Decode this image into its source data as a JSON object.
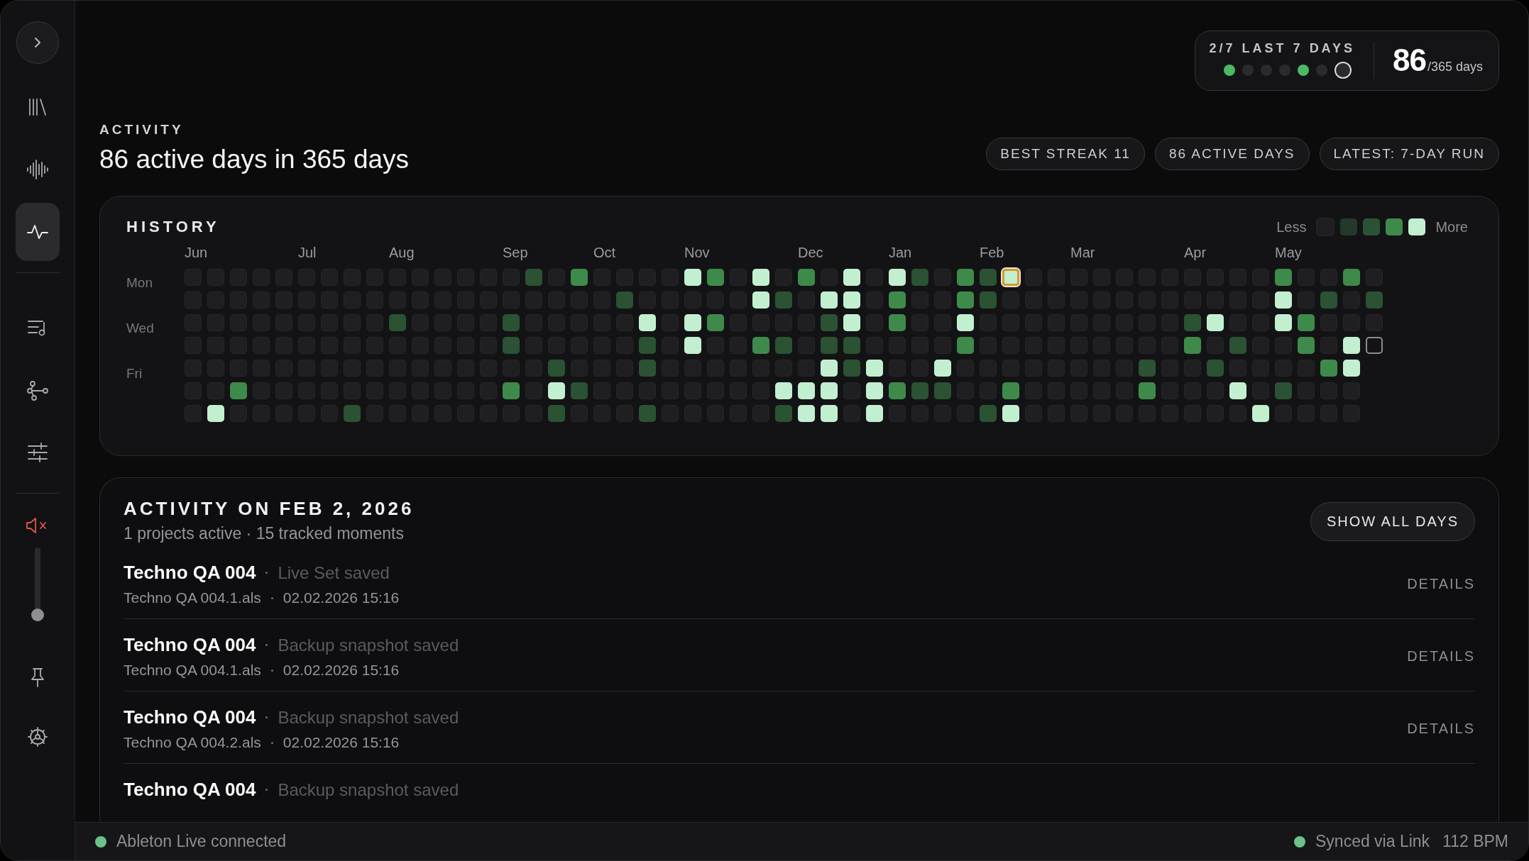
{
  "sidebar": {
    "toggle": {
      "kind": "expand"
    },
    "nav_top": [
      {
        "kind": "library",
        "selected": false
      },
      {
        "kind": "waveform",
        "selected": false
      },
      {
        "kind": "activity",
        "selected": true
      }
    ],
    "nav_mid": [
      {
        "kind": "playlist",
        "selected": false
      },
      {
        "kind": "nodes",
        "selected": false
      },
      {
        "kind": "sliders",
        "selected": false
      }
    ],
    "volume": {
      "muted": true,
      "level": 0
    },
    "nav_bottom": [
      {
        "kind": "pin",
        "selected": false
      },
      {
        "kind": "settings",
        "selected": false
      }
    ]
  },
  "streak": {
    "label": "2/7 LAST 7 DAYS",
    "days": [
      {
        "active": true,
        "current": false
      },
      {
        "active": false,
        "current": false
      },
      {
        "active": false,
        "current": false
      },
      {
        "active": false,
        "current": false
      },
      {
        "active": true,
        "current": false
      },
      {
        "active": false,
        "current": false
      },
      {
        "active": false,
        "current": true
      }
    ],
    "count": "86",
    "total": "/365 days"
  },
  "header": {
    "eyebrow": "ACTIVITY",
    "title": "86 active days in 365 days",
    "chips": [
      "BEST STREAK 11",
      "86 ACTIVE DAYS",
      "LATEST: 7-DAY RUN"
    ]
  },
  "history": {
    "title": "HISTORY",
    "legend": {
      "less": "Less",
      "more": "More",
      "swatches": [
        {
          "kind": "none"
        },
        {
          "kind": "low"
        },
        {
          "kind": "medium"
        },
        {
          "kind": "high"
        },
        {
          "kind": "max"
        }
      ]
    },
    "weekdays": [
      "Mon",
      "Wed",
      "Fri"
    ],
    "weeks": [
      {
        "month": "Jun",
        "days": [
          {
            "kind": "none"
          },
          {
            "kind": "none"
          },
          {
            "kind": "none"
          },
          {
            "kind": "none"
          },
          {
            "kind": "none"
          },
          {
            "kind": "none"
          },
          {
            "kind": "none"
          }
        ]
      },
      {
        "days": [
          {
            "kind": "none"
          },
          {
            "kind": "none"
          },
          {
            "kind": "none"
          },
          {
            "kind": "none"
          },
          {
            "kind": "none"
          },
          {
            "kind": "none"
          },
          {
            "kind": "max"
          }
        ]
      },
      {
        "days": [
          {
            "kind": "none"
          },
          {
            "kind": "none"
          },
          {
            "kind": "none"
          },
          {
            "kind": "none"
          },
          {
            "kind": "none"
          },
          {
            "kind": "high"
          },
          {
            "kind": "none"
          }
        ]
      },
      {
        "days": [
          {
            "kind": "none"
          },
          {
            "kind": "none"
          },
          {
            "kind": "none"
          },
          {
            "kind": "none"
          },
          {
            "kind": "none"
          },
          {
            "kind": "none"
          },
          {
            "kind": "none"
          }
        ]
      },
      {
        "days": [
          {
            "kind": "none"
          },
          {
            "kind": "none"
          },
          {
            "kind": "none"
          },
          {
            "kind": "none"
          },
          {
            "kind": "none"
          },
          {
            "kind": "none"
          },
          {
            "kind": "none"
          }
        ]
      },
      {
        "month": "Jul",
        "days": [
          {
            "kind": "none"
          },
          {
            "kind": "none"
          },
          {
            "kind": "none"
          },
          {
            "kind": "none"
          },
          {
            "kind": "none"
          },
          {
            "kind": "none"
          },
          {
            "kind": "none"
          }
        ]
      },
      {
        "days": [
          {
            "kind": "none"
          },
          {
            "kind": "none"
          },
          {
            "kind": "none"
          },
          {
            "kind": "none"
          },
          {
            "kind": "none"
          },
          {
            "kind": "none"
          },
          {
            "kind": "none"
          }
        ]
      },
      {
        "days": [
          {
            "kind": "none"
          },
          {
            "kind": "none"
          },
          {
            "kind": "none"
          },
          {
            "kind": "none"
          },
          {
            "kind": "none"
          },
          {
            "kind": "none"
          },
          {
            "kind": "medium"
          }
        ]
      },
      {
        "days": [
          {
            "kind": "none"
          },
          {
            "kind": "none"
          },
          {
            "kind": "none"
          },
          {
            "kind": "none"
          },
          {
            "kind": "none"
          },
          {
            "kind": "none"
          },
          {
            "kind": "none"
          }
        ]
      },
      {
        "month": "Aug",
        "days": [
          {
            "kind": "none"
          },
          {
            "kind": "none"
          },
          {
            "kind": "medium"
          },
          {
            "kind": "none"
          },
          {
            "kind": "none"
          },
          {
            "kind": "none"
          },
          {
            "kind": "none"
          }
        ]
      },
      {
        "days": [
          {
            "kind": "none"
          },
          {
            "kind": "none"
          },
          {
            "kind": "none"
          },
          {
            "kind": "none"
          },
          {
            "kind": "none"
          },
          {
            "kind": "none"
          },
          {
            "kind": "none"
          }
        ]
      },
      {
        "days": [
          {
            "kind": "none"
          },
          {
            "kind": "none"
          },
          {
            "kind": "none"
          },
          {
            "kind": "none"
          },
          {
            "kind": "none"
          },
          {
            "kind": "none"
          },
          {
            "kind": "none"
          }
        ]
      },
      {
        "days": [
          {
            "kind": "none"
          },
          {
            "kind": "none"
          },
          {
            "kind": "none"
          },
          {
            "kind": "none"
          },
          {
            "kind": "none"
          },
          {
            "kind": "none"
          },
          {
            "kind": "none"
          }
        ]
      },
      {
        "days": [
          {
            "kind": "none"
          },
          {
            "kind": "none"
          },
          {
            "kind": "none"
          },
          {
            "kind": "none"
          },
          {
            "kind": "none"
          },
          {
            "kind": "none"
          },
          {
            "kind": "none"
          }
        ]
      },
      {
        "month": "Sep",
        "days": [
          {
            "kind": "none"
          },
          {
            "kind": "none"
          },
          {
            "kind": "medium"
          },
          {
            "kind": "medium"
          },
          {
            "kind": "none"
          },
          {
            "kind": "high"
          },
          {
            "kind": "none"
          }
        ]
      },
      {
        "days": [
          {
            "kind": "medium"
          },
          {
            "kind": "none"
          },
          {
            "kind": "none"
          },
          {
            "kind": "none"
          },
          {
            "kind": "none"
          },
          {
            "kind": "none"
          },
          {
            "kind": "none"
          }
        ]
      },
      {
        "days": [
          {
            "kind": "none"
          },
          {
            "kind": "none"
          },
          {
            "kind": "none"
          },
          {
            "kind": "none"
          },
          {
            "kind": "medium"
          },
          {
            "kind": "max"
          },
          {
            "kind": "medium"
          }
        ]
      },
      {
        "days": [
          {
            "kind": "high"
          },
          {
            "kind": "none"
          },
          {
            "kind": "none"
          },
          {
            "kind": "none"
          },
          {
            "kind": "none"
          },
          {
            "kind": "medium"
          },
          {
            "kind": "none"
          }
        ]
      },
      {
        "month": "Oct",
        "days": [
          {
            "kind": "none"
          },
          {
            "kind": "none"
          },
          {
            "kind": "none"
          },
          {
            "kind": "none"
          },
          {
            "kind": "none"
          },
          {
            "kind": "none"
          },
          {
            "kind": "none"
          }
        ]
      },
      {
        "days": [
          {
            "kind": "none"
          },
          {
            "kind": "medium"
          },
          {
            "kind": "none"
          },
          {
            "kind": "none"
          },
          {
            "kind": "none"
          },
          {
            "kind": "none"
          },
          {
            "kind": "none"
          }
        ]
      },
      {
        "days": [
          {
            "kind": "none"
          },
          {
            "kind": "none"
          },
          {
            "kind": "max"
          },
          {
            "kind": "medium"
          },
          {
            "kind": "medium"
          },
          {
            "kind": "none"
          },
          {
            "kind": "medium"
          }
        ]
      },
      {
        "days": [
          {
            "kind": "none"
          },
          {
            "kind": "none"
          },
          {
            "kind": "none"
          },
          {
            "kind": "none"
          },
          {
            "kind": "none"
          },
          {
            "kind": "none"
          },
          {
            "kind": "none"
          }
        ]
      },
      {
        "month": "Nov",
        "days": [
          {
            "kind": "max"
          },
          {
            "kind": "none"
          },
          {
            "kind": "max"
          },
          {
            "kind": "max"
          },
          {
            "kind": "none"
          },
          {
            "kind": "none"
          },
          {
            "kind": "none"
          }
        ]
      },
      {
        "days": [
          {
            "kind": "high"
          },
          {
            "kind": "none"
          },
          {
            "kind": "high"
          },
          {
            "kind": "none"
          },
          {
            "kind": "none"
          },
          {
            "kind": "none"
          },
          {
            "kind": "none"
          }
        ]
      },
      {
        "days": [
          {
            "kind": "none"
          },
          {
            "kind": "none"
          },
          {
            "kind": "none"
          },
          {
            "kind": "none"
          },
          {
            "kind": "none"
          },
          {
            "kind": "none"
          },
          {
            "kind": "none"
          }
        ]
      },
      {
        "days": [
          {
            "kind": "max"
          },
          {
            "kind": "max"
          },
          {
            "kind": "none"
          },
          {
            "kind": "high"
          },
          {
            "kind": "none"
          },
          {
            "kind": "none"
          },
          {
            "kind": "none"
          }
        ]
      },
      {
        "days": [
          {
            "kind": "none"
          },
          {
            "kind": "medium"
          },
          {
            "kind": "none"
          },
          {
            "kind": "medium"
          },
          {
            "kind": "none"
          },
          {
            "kind": "max"
          },
          {
            "kind": "medium"
          }
        ]
      },
      {
        "month": "Dec",
        "days": [
          {
            "kind": "high"
          },
          {
            "kind": "none"
          },
          {
            "kind": "none"
          },
          {
            "kind": "none"
          },
          {
            "kind": "none"
          },
          {
            "kind": "max"
          },
          {
            "kind": "max"
          }
        ]
      },
      {
        "days": [
          {
            "kind": "none"
          },
          {
            "kind": "max"
          },
          {
            "kind": "medium"
          },
          {
            "kind": "medium"
          },
          {
            "kind": "max"
          },
          {
            "kind": "max"
          },
          {
            "kind": "max"
          }
        ]
      },
      {
        "days": [
          {
            "kind": "max"
          },
          {
            "kind": "max"
          },
          {
            "kind": "max"
          },
          {
            "kind": "medium"
          },
          {
            "kind": "medium"
          },
          {
            "kind": "none"
          },
          {
            "kind": "none"
          }
        ]
      },
      {
        "days": [
          {
            "kind": "none"
          },
          {
            "kind": "none"
          },
          {
            "kind": "none"
          },
          {
            "kind": "none"
          },
          {
            "kind": "max"
          },
          {
            "kind": "max"
          },
          {
            "kind": "max"
          }
        ]
      },
      {
        "month": "Jan",
        "days": [
          {
            "kind": "max"
          },
          {
            "kind": "high"
          },
          {
            "kind": "high"
          },
          {
            "kind": "none"
          },
          {
            "kind": "none"
          },
          {
            "kind": "high"
          },
          {
            "kind": "none"
          }
        ]
      },
      {
        "days": [
          {
            "kind": "medium"
          },
          {
            "kind": "none"
          },
          {
            "kind": "none"
          },
          {
            "kind": "none"
          },
          {
            "kind": "none"
          },
          {
            "kind": "medium"
          },
          {
            "kind": "none"
          }
        ]
      },
      {
        "days": [
          {
            "kind": "none"
          },
          {
            "kind": "none"
          },
          {
            "kind": "none"
          },
          {
            "kind": "none"
          },
          {
            "kind": "max"
          },
          {
            "kind": "medium"
          },
          {
            "kind": "none"
          }
        ]
      },
      {
        "days": [
          {
            "kind": "high"
          },
          {
            "kind": "high"
          },
          {
            "kind": "max"
          },
          {
            "kind": "high"
          },
          {
            "kind": "none"
          },
          {
            "kind": "none"
          },
          {
            "kind": "none"
          }
        ]
      },
      {
        "month": "Feb",
        "days": [
          {
            "kind": "medium"
          },
          {
            "kind": "medium"
          },
          {
            "kind": "none"
          },
          {
            "kind": "none"
          },
          {
            "kind": "none"
          },
          {
            "kind": "none"
          },
          {
            "kind": "medium"
          }
        ]
      },
      {
        "days": [
          {
            "kind": "selected"
          },
          {
            "kind": "none"
          },
          {
            "kind": "none"
          },
          {
            "kind": "none"
          },
          {
            "kind": "none"
          },
          {
            "kind": "high"
          },
          {
            "kind": "max"
          }
        ]
      },
      {
        "days": [
          {
            "kind": "none"
          },
          {
            "kind": "none"
          },
          {
            "kind": "none"
          },
          {
            "kind": "none"
          },
          {
            "kind": "none"
          },
          {
            "kind": "none"
          },
          {
            "kind": "none"
          }
        ]
      },
      {
        "days": [
          {
            "kind": "none"
          },
          {
            "kind": "none"
          },
          {
            "kind": "none"
          },
          {
            "kind": "none"
          },
          {
            "kind": "none"
          },
          {
            "kind": "none"
          },
          {
            "kind": "none"
          }
        ]
      },
      {
        "month": "Mar",
        "days": [
          {
            "kind": "none"
          },
          {
            "kind": "none"
          },
          {
            "kind": "none"
          },
          {
            "kind": "none"
          },
          {
            "kind": "none"
          },
          {
            "kind": "none"
          },
          {
            "kind": "none"
          }
        ]
      },
      {
        "days": [
          {
            "kind": "none"
          },
          {
            "kind": "none"
          },
          {
            "kind": "none"
          },
          {
            "kind": "none"
          },
          {
            "kind": "none"
          },
          {
            "kind": "none"
          },
          {
            "kind": "none"
          }
        ]
      },
      {
        "days": [
          {
            "kind": "none"
          },
          {
            "kind": "none"
          },
          {
            "kind": "none"
          },
          {
            "kind": "none"
          },
          {
            "kind": "none"
          },
          {
            "kind": "none"
          },
          {
            "kind": "none"
          }
        ]
      },
      {
        "days": [
          {
            "kind": "none"
          },
          {
            "kind": "none"
          },
          {
            "kind": "none"
          },
          {
            "kind": "none"
          },
          {
            "kind": "medium"
          },
          {
            "kind": "high"
          },
          {
            "kind": "none"
          }
        ]
      },
      {
        "days": [
          {
            "kind": "none"
          },
          {
            "kind": "none"
          },
          {
            "kind": "none"
          },
          {
            "kind": "none"
          },
          {
            "kind": "none"
          },
          {
            "kind": "none"
          },
          {
            "kind": "none"
          }
        ]
      },
      {
        "month": "Apr",
        "days": [
          {
            "kind": "none"
          },
          {
            "kind": "none"
          },
          {
            "kind": "medium"
          },
          {
            "kind": "high"
          },
          {
            "kind": "none"
          },
          {
            "kind": "none"
          },
          {
            "kind": "none"
          }
        ]
      },
      {
        "days": [
          {
            "kind": "none"
          },
          {
            "kind": "none"
          },
          {
            "kind": "max"
          },
          {
            "kind": "none"
          },
          {
            "kind": "medium"
          },
          {
            "kind": "none"
          },
          {
            "kind": "none"
          }
        ]
      },
      {
        "days": [
          {
            "kind": "none"
          },
          {
            "kind": "none"
          },
          {
            "kind": "none"
          },
          {
            "kind": "medium"
          },
          {
            "kind": "none"
          },
          {
            "kind": "max"
          },
          {
            "kind": "none"
          }
        ]
      },
      {
        "days": [
          {
            "kind": "none"
          },
          {
            "kind": "none"
          },
          {
            "kind": "none"
          },
          {
            "kind": "none"
          },
          {
            "kind": "none"
          },
          {
            "kind": "none"
          },
          {
            "kind": "max"
          }
        ]
      },
      {
        "month": "May",
        "days": [
          {
            "kind": "high"
          },
          {
            "kind": "max"
          },
          {
            "kind": "max"
          },
          {
            "kind": "none"
          },
          {
            "kind": "none"
          },
          {
            "kind": "medium"
          },
          {
            "kind": "none"
          }
        ]
      },
      {
        "days": [
          {
            "kind": "none"
          },
          {
            "kind": "none"
          },
          {
            "kind": "high"
          },
          {
            "kind": "high"
          },
          {
            "kind": "none"
          },
          {
            "kind": "none"
          },
          {
            "kind": "none"
          }
        ]
      },
      {
        "days": [
          {
            "kind": "none"
          },
          {
            "kind": "medium"
          },
          {
            "kind": "none"
          },
          {
            "kind": "none"
          },
          {
            "kind": "high"
          },
          {
            "kind": "none"
          },
          {
            "kind": "none"
          }
        ]
      },
      {
        "days": [
          {
            "kind": "high"
          },
          {
            "kind": "none"
          },
          {
            "kind": "none"
          },
          {
            "kind": "max"
          },
          {
            "kind": "max"
          },
          {
            "kind": "none"
          },
          {
            "kind": "none"
          }
        ]
      },
      {
        "days": [
          {
            "kind": "none"
          },
          {
            "kind": "medium"
          },
          {
            "kind": "none"
          },
          {
            "kind": "today"
          }
        ]
      }
    ]
  },
  "day_detail": {
    "title": "ACTIVITY ON FEB 2, 2026",
    "summary": "1 projects active · 15 tracked moments",
    "button": "SHOW ALL DAYS",
    "entries": [
      {
        "project": "Techno QA 004",
        "event": "Live Set saved",
        "file": "Techno QA 004.1.als",
        "time": "02.02.2026 15:16",
        "action": "DETAILS"
      },
      {
        "project": "Techno QA 004",
        "event": "Backup snapshot saved",
        "file": "Techno QA 004.1.als",
        "time": "02.02.2026 15:16",
        "action": "DETAILS"
      },
      {
        "project": "Techno QA 004",
        "event": "Backup snapshot saved",
        "file": "Techno QA 004.2.als",
        "time": "02.02.2026 15:16",
        "action": "DETAILS"
      },
      {
        "project": "Techno QA 004",
        "event": "Backup snapshot saved"
      }
    ]
  },
  "status_bar": {
    "left": {
      "text": "Ableton Live connected",
      "connected": true
    },
    "right": {
      "text": "Synced via Link",
      "connected": true
    },
    "tempo": "112 BPM"
  }
}
